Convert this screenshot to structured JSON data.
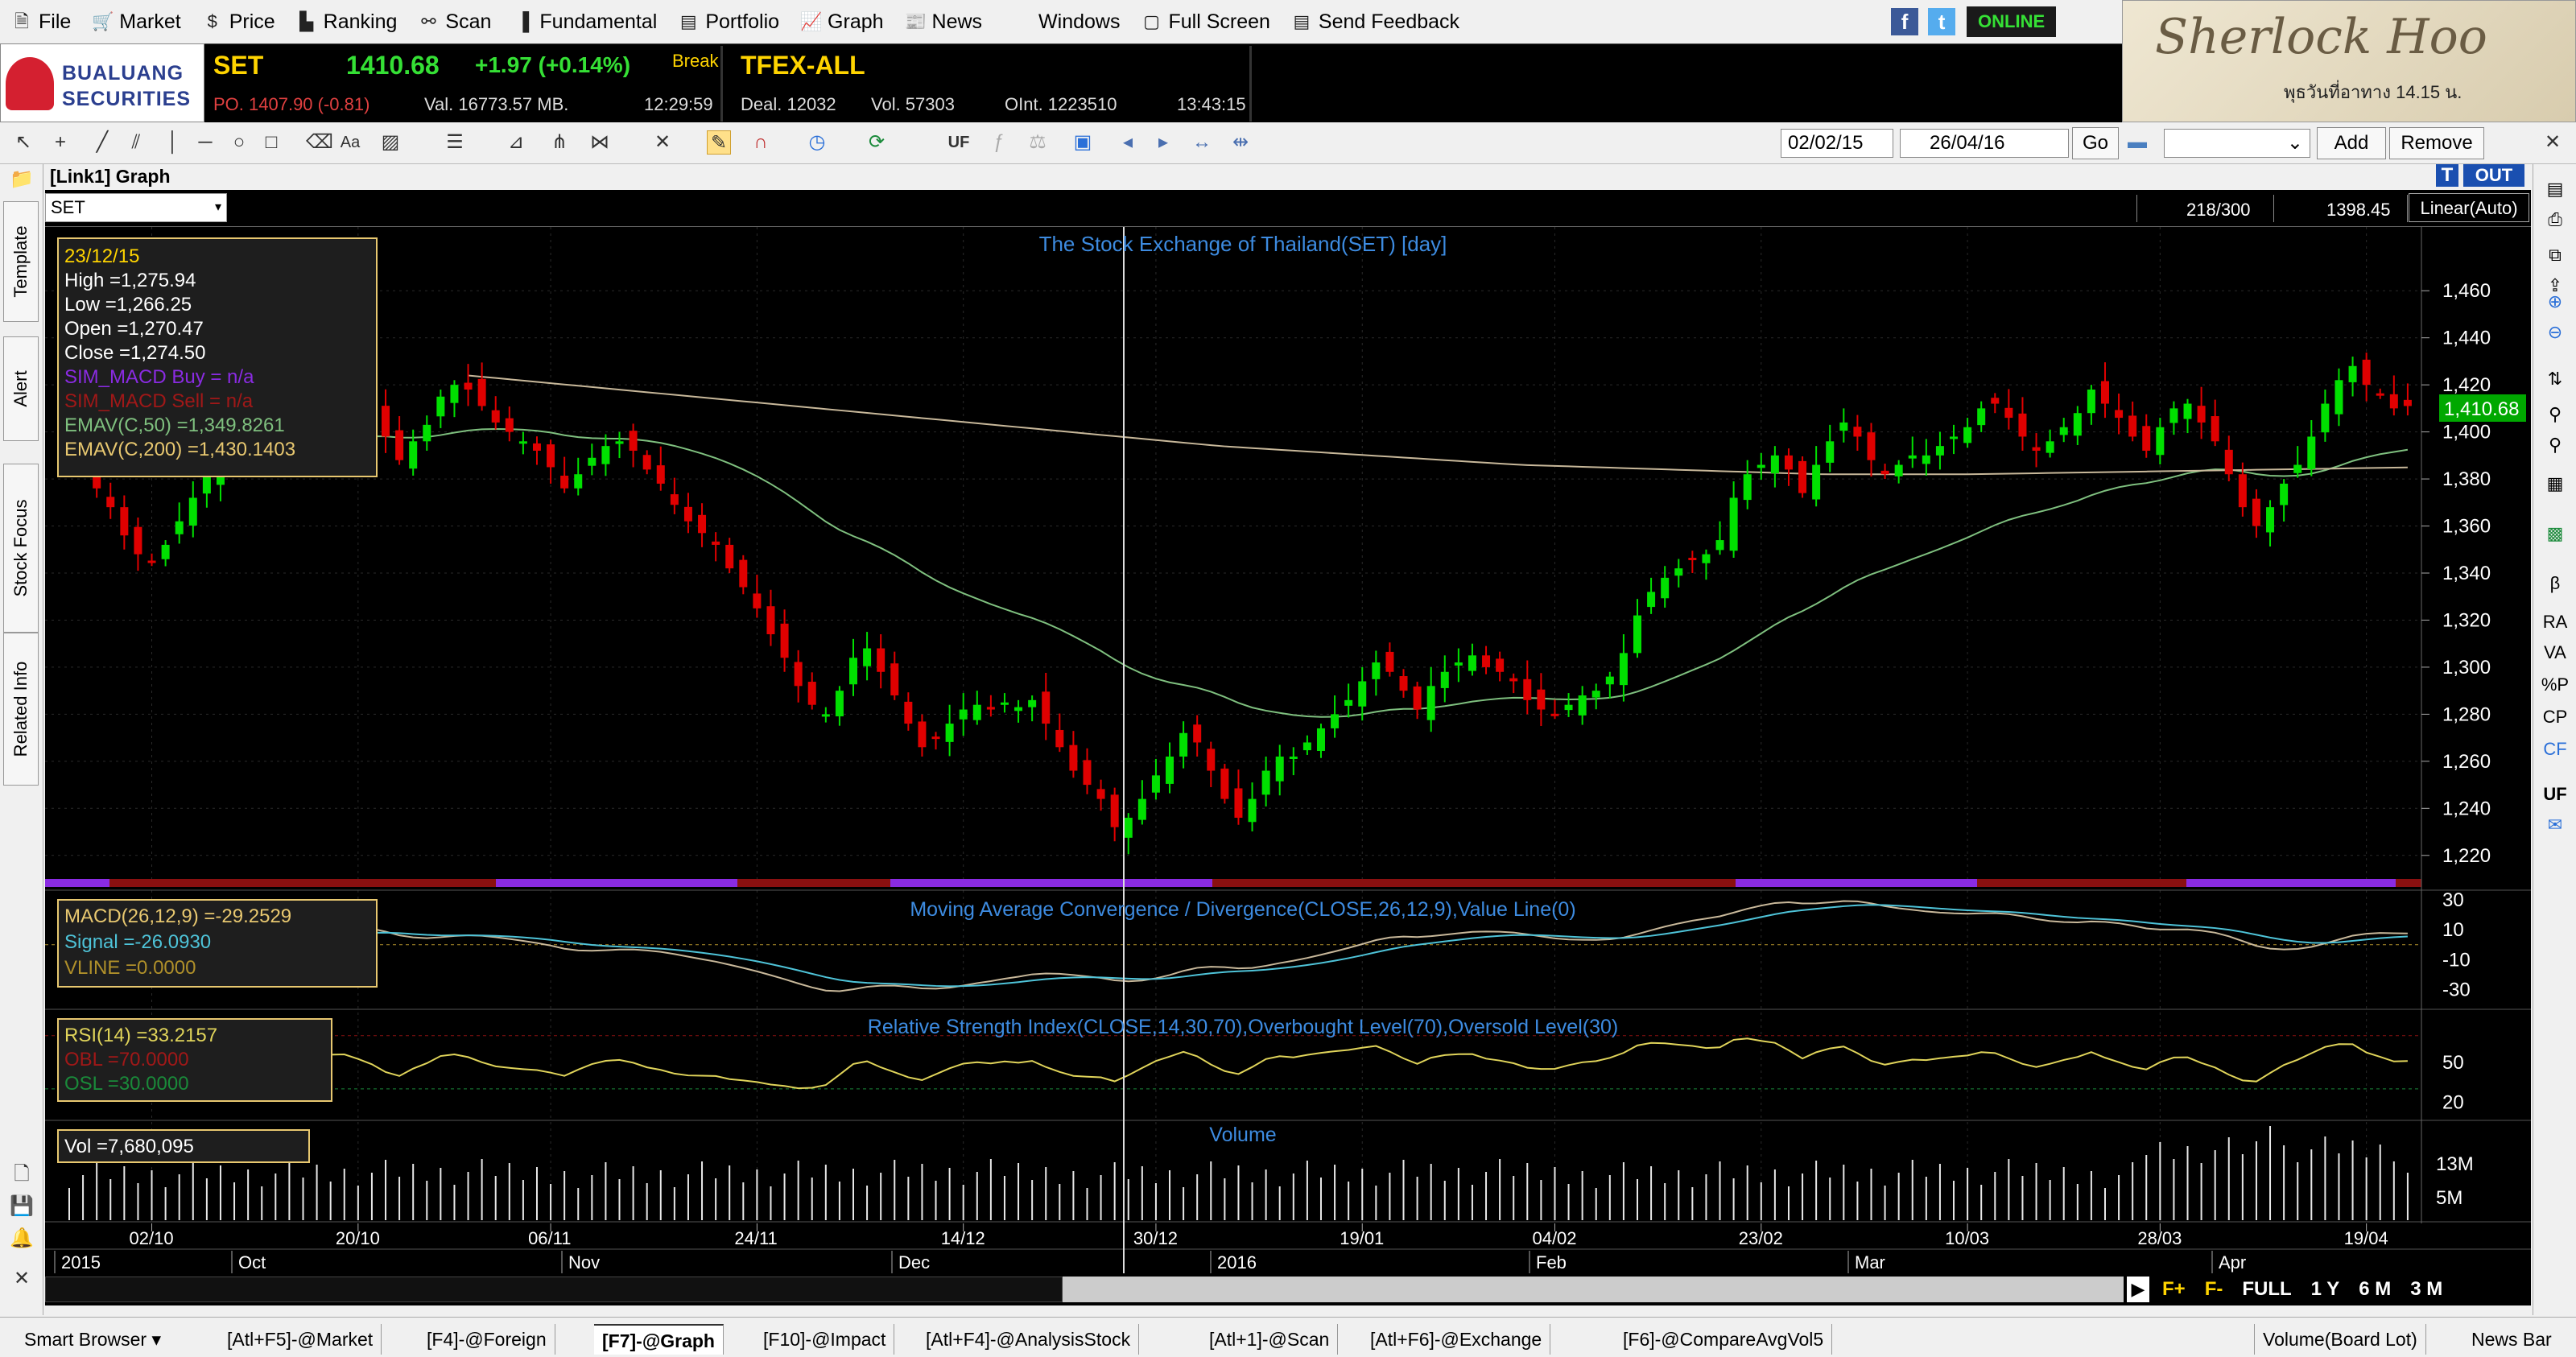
{
  "menu": [
    {
      "label": "File",
      "icon": "file-icon"
    },
    {
      "label": "Market",
      "icon": "market-icon"
    },
    {
      "label": "Price",
      "icon": "price-icon"
    },
    {
      "label": "Ranking",
      "icon": "ranking-icon"
    },
    {
      "label": "Scan",
      "icon": "scan-icon"
    },
    {
      "label": "Fundamental",
      "icon": "fundamental-icon"
    },
    {
      "label": "Portfolio",
      "icon": "portfolio-icon"
    },
    {
      "label": "Graph",
      "icon": "graph-icon"
    },
    {
      "label": "News",
      "icon": "news-icon"
    },
    {
      "label": "Windows",
      "icon": ""
    },
    {
      "label": "Full Screen",
      "icon": "fullscreen-icon"
    },
    {
      "label": "Send Feedback",
      "icon": "feedback-icon"
    }
  ],
  "status": "ONLINE",
  "broker": {
    "line1": "BUALUANG",
    "line2": "SECURITIES"
  },
  "banner": {
    "text": "Sherlock Hoo",
    "sub": "พุธวันที่อาทาง 14.15 น."
  },
  "ticker": {
    "symbol": "SET",
    "price": "1410.68",
    "change": "+1.97 (+0.14%)",
    "session": "Break",
    "po": "PO. 1407.90 (-0.81)",
    "val": "Val. 16773.57 MB.",
    "time1": "12:29:59",
    "tfex": "TFEX-ALL",
    "deal": "Deal. 12032",
    "vol": "Vol. 57303",
    "oint": "OInt. 1223510",
    "time2": "13:43:15"
  },
  "toolbar": {
    "uf": "UF",
    "date_from": "02/02/15",
    "date_to": "26/04/16",
    "go": "Go",
    "add": "Add",
    "remove": "Remove"
  },
  "graph": {
    "title": "[Link1] Graph",
    "t": "T",
    "out": "OUT",
    "symbol": "SET",
    "count": "218/300",
    "cursor_value": "1398.45",
    "scale": "Linear(Auto)"
  },
  "left_tabs": [
    "Template",
    "Alert",
    "Stock Focus",
    "Related Info"
  ],
  "right_tools": [
    "RA",
    "VA",
    "%P",
    "CP",
    "CF",
    "UF"
  ],
  "chart_data": {
    "type": "candlestick",
    "title": "The Stock Exchange of Thailand(SET) [day]",
    "info_box": {
      "date": "23/12/15",
      "high": "High  =1,275.94",
      "low": "Low  =1,266.25",
      "open": "Open  =1,270.47",
      "close": "Close  =1,274.50",
      "sim_buy": "SIM_MACD Buy   = n/a",
      "sim_sell": "SIM_MACD Sell   = n/a",
      "ema50": "EMAV(C,50)   =1,349.8261",
      "ema200": "EMAV(C,200)   =1,430.1403"
    },
    "y_ticks": [
      1220,
      1240,
      1260,
      1280,
      1300,
      1320,
      1340,
      1360,
      1380,
      1400,
      1420,
      1440,
      1460
    ],
    "y_range": [
      1210,
      1470
    ],
    "last_price": "1,410.68",
    "closes": [
      1395,
      1388,
      1376,
      1368,
      1356,
      1348,
      1345,
      1352,
      1362,
      1372,
      1382,
      1392,
      1402,
      1410,
      1420,
      1424,
      1421,
      1418,
      1420,
      1422,
      1425,
      1420,
      1412,
      1398,
      1388,
      1396,
      1403,
      1415,
      1420,
      1418,
      1411,
      1404,
      1400,
      1396,
      1392,
      1385,
      1376,
      1382,
      1389,
      1394,
      1396,
      1392,
      1384,
      1378,
      1369,
      1362,
      1357,
      1352,
      1342,
      1334,
      1325,
      1314,
      1304,
      1292,
      1284,
      1280,
      1290,
      1304,
      1308,
      1298,
      1288,
      1276,
      1266,
      1270,
      1276,
      1282,
      1284,
      1282,
      1285,
      1283,
      1286,
      1276,
      1266,
      1256,
      1250,
      1244,
      1232,
      1236,
      1244,
      1254,
      1262,
      1272,
      1268,
      1256,
      1244,
      1236,
      1244,
      1256,
      1262,
      1262,
      1268,
      1274,
      1280,
      1286,
      1294,
      1302,
      1298,
      1290,
      1282,
      1292,
      1298,
      1302,
      1305,
      1300,
      1298,
      1294,
      1286,
      1282,
      1280,
      1284,
      1288,
      1290,
      1296,
      1306,
      1322,
      1332,
      1338,
      1342,
      1346,
      1348,
      1354,
      1372,
      1382,
      1386,
      1390,
      1384,
      1374,
      1386,
      1396,
      1404,
      1398,
      1388,
      1382,
      1386,
      1390,
      1390,
      1394,
      1398,
      1402,
      1410,
      1412,
      1406,
      1398,
      1392,
      1396,
      1402,
      1408,
      1418,
      1412,
      1406,
      1398,
      1392,
      1402,
      1410,
      1412,
      1404,
      1396,
      1382,
      1368,
      1360,
      1368,
      1378,
      1386,
      1398,
      1412,
      1422,
      1428,
      1420,
      1416,
      1410,
      1411
    ],
    "x_labels": [
      "02/10",
      "20/10",
      "06/11",
      "24/11",
      "14/12",
      "30/12",
      "19/01",
      "04/02",
      "23/02",
      "10/03",
      "28/03",
      "19/04"
    ],
    "period_labels": [
      "2015",
      "Oct",
      "Nov",
      "Dec",
      "2016",
      "Feb",
      "Mar",
      "Apr"
    ],
    "macd": {
      "title": "Moving Average Convergence / Divergence(CLOSE,26,12,9),Value Line(0)",
      "macd_label": "MACD(26,12,9)   =-29.2529",
      "signal_label": "Signal   =-26.0930",
      "vline_label": "VLINE   =0.0000",
      "y_ticks": [
        "30",
        "10",
        "-10",
        "-30"
      ]
    },
    "rsi": {
      "title": "Relative Strength Index(CLOSE,14,30,70),Overbought Level(70),Oversold Level(30)",
      "rsi_label": "RSI(14)   =33.2157",
      "obl_label": "OBL   =70.0000",
      "osl_label": "OSL   =30.0000",
      "y_ticks": [
        "50",
        "20"
      ]
    },
    "volume": {
      "title": "Volume",
      "vol_label": "Vol   =7,680,095",
      "y_ticks": [
        "13M",
        "5M"
      ]
    }
  },
  "bottom_nav": [
    "F+",
    "F-",
    "FULL",
    "1 Y",
    "6 M",
    "3 M"
  ],
  "taskbar": {
    "smart_browser": "Smart Browser",
    "tabs": [
      "[Atl+F5]-@Market",
      "[F4]-@Foreign",
      "[F7]-@Graph",
      "[F10]-@Impact",
      "[Atl+F4]-@AnalysisStock",
      "[Atl+1]-@Scan",
      "[Atl+F6]-@Exchange",
      "[F6]-@CompareAvgVol5"
    ],
    "active_tab": "[F7]-@Graph",
    "volume_board": "Volume(Board Lot)",
    "news_bar": "News Bar"
  },
  "colors": {
    "up": "#00e000",
    "down": "#e00000",
    "ema50": "#7fc07f",
    "ema200": "#c8b89a",
    "label_blue": "#3d8be0",
    "macd": "#c8b89a",
    "signal": "#4ec3d8",
    "rsi": "#e0d45a"
  }
}
